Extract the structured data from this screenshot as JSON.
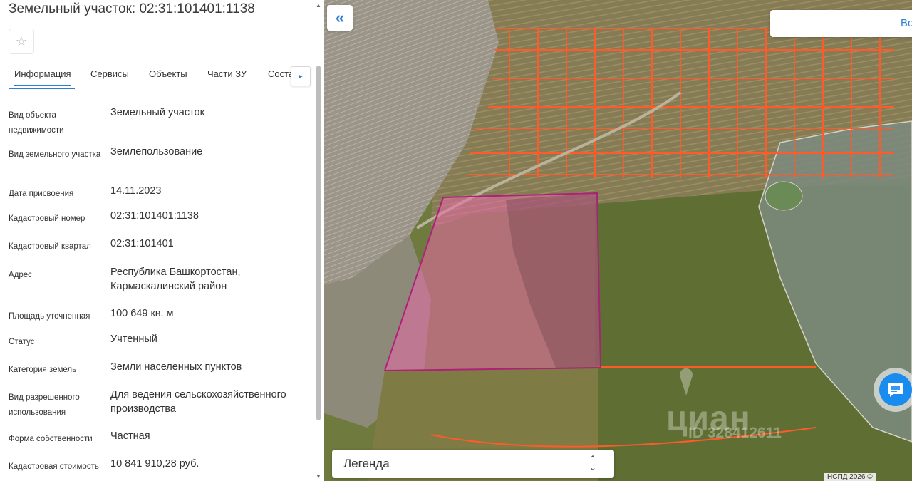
{
  "header": {
    "title": "Земельный участок: 02:31:101401:1138"
  },
  "tabs": [
    "Информация",
    "Сервисы",
    "Объекты",
    "Части ЗУ",
    "Соста"
  ],
  "tabs_more_glyph": "▸",
  "favorite_glyph": "☆",
  "fields": [
    {
      "label": "Вид объекта недвижимости",
      "value": "Земельный участок"
    },
    {
      "label": "Вид земельного участка",
      "value": "Землепользование"
    },
    {
      "label": "Дата присвоения",
      "value": "14.11.2023"
    },
    {
      "label": "Кадастровый номер",
      "value": "02:31:101401:1138"
    },
    {
      "label": "Кадастровый квартал",
      "value": "02:31:101401"
    },
    {
      "label": "Адрес",
      "value": "Республика Башкортостан, Кармаскалинский район"
    },
    {
      "label": "Площадь уточненная",
      "value": "100 649 кв. м"
    },
    {
      "label": "Статус",
      "value": "Учтенный"
    },
    {
      "label": "Категория земель",
      "value": "Земли населенных пунктов"
    },
    {
      "label": "Вид разрешенного использования",
      "value": "Для ведения сельскохозяйственного производства"
    },
    {
      "label": "Форма собственности",
      "value": "Частная"
    },
    {
      "label": "Кадастровая стоимость",
      "value": "10 841 910,28 руб."
    }
  ],
  "map": {
    "collapse_glyph": "«",
    "search_text": "Во",
    "legend_label": "Легенда",
    "legend_arrows": "⌃⌄",
    "watermark_logo": "циан",
    "watermark_id": "ID 328412611",
    "copyright": "НСПД 2026 ©"
  },
  "colors": {
    "accent": "#2e7fd0",
    "parcel_outline": "#b0207a",
    "parcel_fill": "#e86aa6",
    "cadastral_lines": "#ff5a2a",
    "chat_button": "#1a8cf0"
  }
}
